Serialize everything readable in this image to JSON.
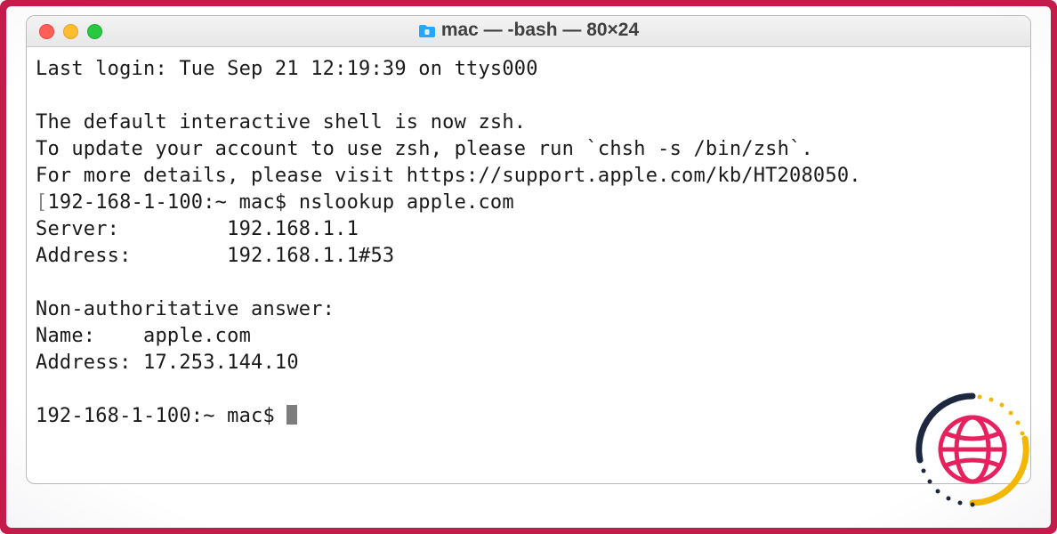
{
  "window": {
    "title": "mac — -bash — 80×24"
  },
  "terminal": {
    "lines": [
      "Last login: Tue Sep 21 12:19:39 on ttys000",
      "",
      "The default interactive shell is now zsh.",
      "To update your account to use zsh, please run `chsh -s /bin/zsh`.",
      "For more details, please visit https://support.apple.com/kb/HT208050."
    ],
    "prompt1_prefix": "[",
    "prompt1": "192-168-1-100:~ mac$ ",
    "command1": "nslookup apple.com",
    "prompt1_suffix": "]",
    "output": [
      "Server:         192.168.1.1",
      "Address:        192.168.1.1#53",
      "",
      "Non-authoritative answer:",
      "Name:    apple.com",
      "Address: 17.253.144.10",
      ""
    ],
    "prompt2": "192-168-1-100:~ mac$ "
  },
  "colors": {
    "frame": "#c41b4a",
    "watermark_pink": "#e6215d",
    "watermark_yellow": "#f3b700",
    "watermark_navy": "#1d2740"
  }
}
